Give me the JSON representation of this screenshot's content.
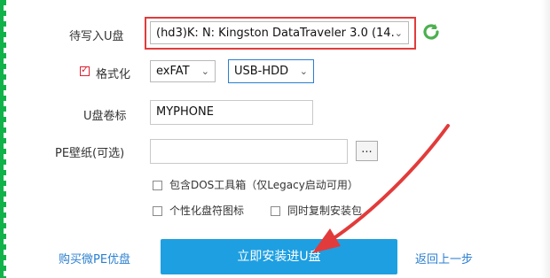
{
  "form": {
    "usb_label": "待写入U盘",
    "usb_selected": "(hd3)K: N: Kingston DataTraveler 3.0 (14.",
    "format_label": "格式化",
    "format_checked": true,
    "fs_selected": "exFAT",
    "mode_selected": "USB-HDD",
    "volume_label": "U盘卷标",
    "volume_value": "MYPHONE",
    "wallpaper_label": "PE壁纸(可选)",
    "wallpaper_value": "",
    "browse_label": "...",
    "option_dos": "包含DOS工具箱（仅Legacy启动可用）",
    "option_icon": "个性化盘符图标",
    "option_copy": "同时复制安装包"
  },
  "footer": {
    "buy_link": "购买微PE优盘",
    "install_button": "立即安装进U盘",
    "back_link": "返回上一步"
  },
  "colors": {
    "accent": "#1e9fe1",
    "highlight": "#e23b3b",
    "arrow": "#e23b3b",
    "refresh": "#4caf50"
  }
}
